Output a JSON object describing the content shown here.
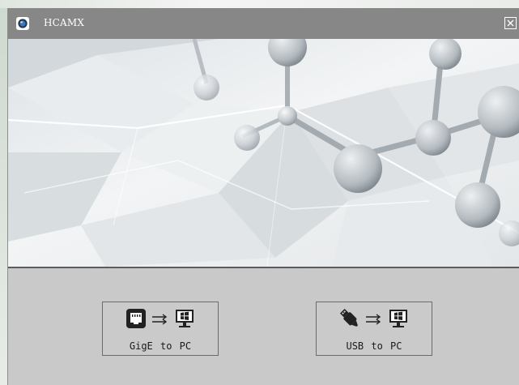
{
  "window": {
    "title": "HCAMX",
    "icons": {
      "app": "app-globe-icon",
      "close": "close-icon"
    }
  },
  "banner": {
    "description_icon": "molecule-banner-graphic"
  },
  "modes": [
    {
      "label": "GigE to PC",
      "source_icon": "ethernet-port-icon",
      "arrow_icon": "double-arrow-icon",
      "target_icon": "windows-pc-icon"
    },
    {
      "label": "USB to PC",
      "source_icon": "usb-plug-icon",
      "arrow_icon": "double-arrow-icon",
      "target_icon": "windows-pc-icon"
    }
  ],
  "colors": {
    "titlebar": "#878787",
    "panel": "#c9c9c9",
    "icon_dark": "#222222"
  }
}
